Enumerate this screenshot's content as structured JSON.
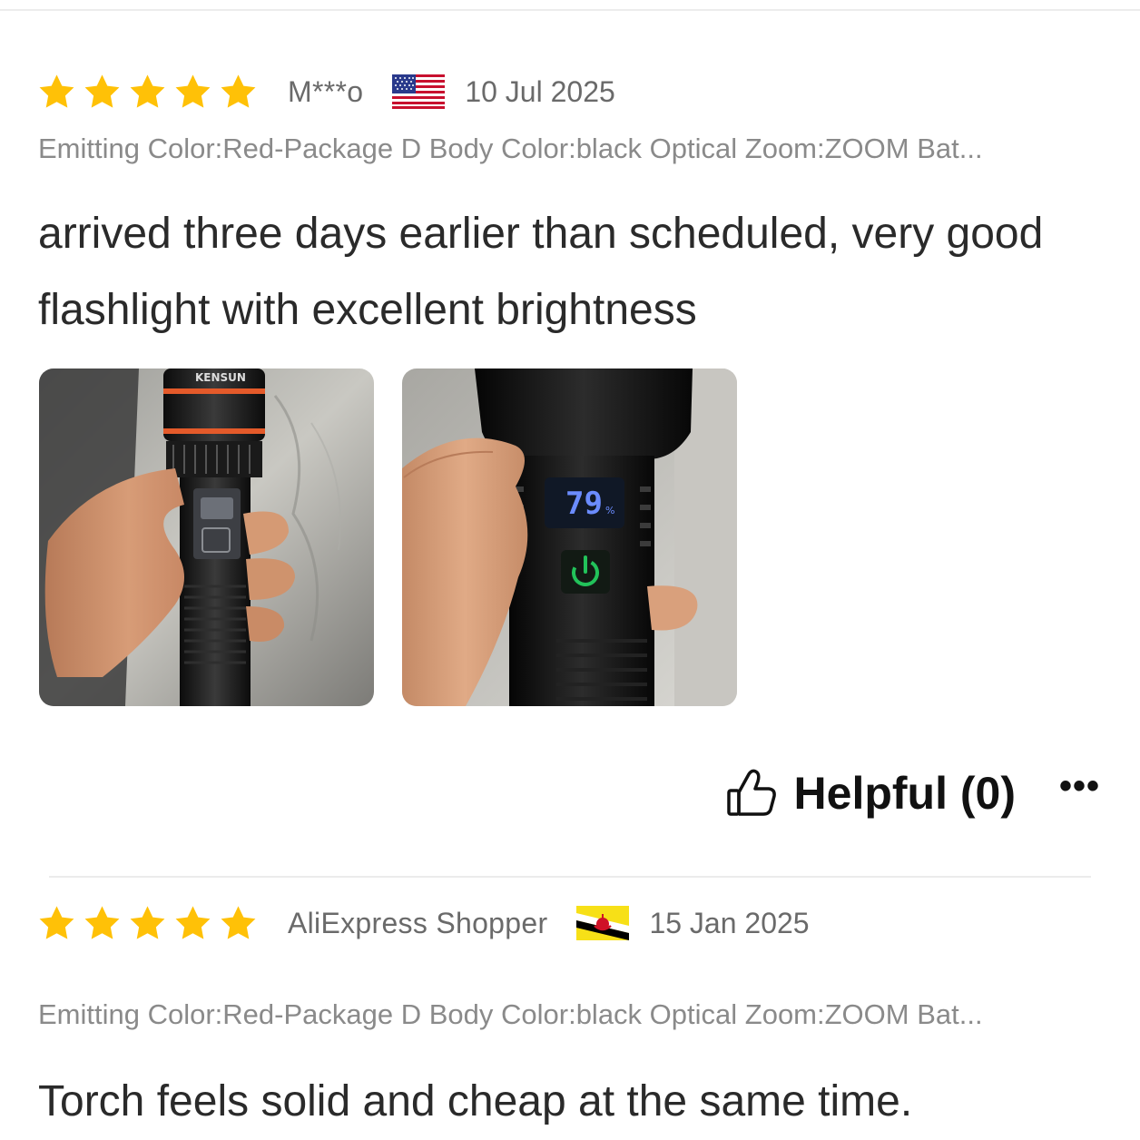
{
  "reviews": [
    {
      "rating": 5,
      "author": "M***o",
      "country_flag": "us-flag",
      "date": "10 Jul 2025",
      "sku": "Emitting Color:Red-Package D Body Color:black Optical Zoom:ZOOM Bat...",
      "text": "arrived three days earlier than scheduled, very good flashlight with excellent brightness",
      "photos": [
        {
          "brand_text": "KENSUN"
        },
        {
          "display_text": "79",
          "display_unit": "%"
        }
      ],
      "helpful_label": "Helpful (0)",
      "more_label": "•••"
    },
    {
      "rating": 5,
      "author": "AliExpress Shopper",
      "country_flag": "brunei-flag",
      "date": "15 Jan 2025",
      "sku": "Emitting Color:Red-Package D Body Color:black Optical Zoom:ZOOM Bat...",
      "text": "Torch feels solid and cheap at the same time."
    }
  ],
  "colors": {
    "star": "#ffc107",
    "meta_text": "#6a6a6a",
    "sku_text": "#8a8a8a",
    "body_text": "#2a2a2a",
    "divider": "#ebebeb"
  },
  "icons": {
    "star": "star-icon",
    "thumb": "thumbs-up-icon",
    "more": "more-icon"
  }
}
